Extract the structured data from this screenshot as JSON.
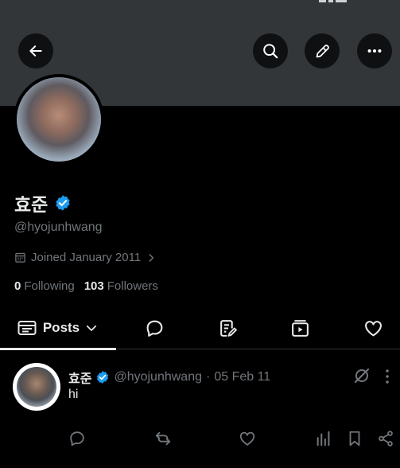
{
  "header": {
    "back_icon": "arrow-left-icon",
    "search_icon": "search-icon",
    "edit_icon": "pen-icon",
    "more_icon": "more-horizontal-icon",
    "banner_color": "#333639"
  },
  "profile": {
    "display_name": "효준",
    "verified": true,
    "verified_color": "#1d9bf0",
    "handle": "@hyojunhwang",
    "joined": "Joined January 2011",
    "following_count": "0",
    "following_label": "Following",
    "followers_count": "103",
    "followers_label": "Followers"
  },
  "tabs": {
    "posts_label": "Posts",
    "active": "posts",
    "icons": [
      "chat-bubble-icon",
      "article-icon",
      "media-icon",
      "heart-icon"
    ]
  },
  "post": {
    "author_name": "효준",
    "author_handle": "@hyojunhwang",
    "separator": "·",
    "date": "05 Feb 11",
    "text": "hi"
  },
  "colors": {
    "background": "#000000",
    "text_primary": "#e7e9ea",
    "text_secondary": "#71767b",
    "divider": "#2f3336"
  }
}
